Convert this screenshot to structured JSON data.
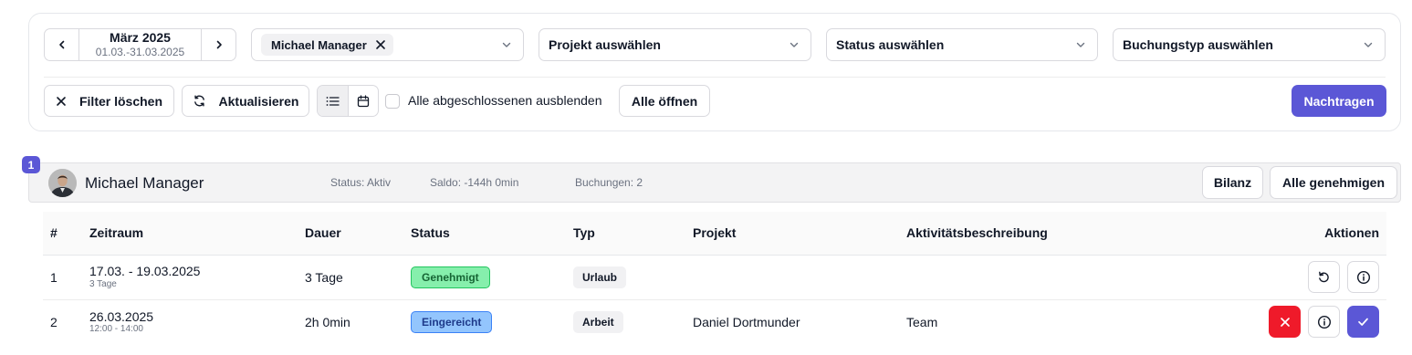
{
  "filters": {
    "month_nav": {
      "title": "März 2025",
      "range": "01.03.-31.03.2025"
    },
    "user_select": {
      "selected_chip": "Michael Manager"
    },
    "project_select": {
      "placeholder": "Projekt auswählen"
    },
    "status_select": {
      "placeholder": "Status auswählen"
    },
    "booking_type_select": {
      "placeholder": "Buchungstyp auswählen"
    },
    "clear_label": "Filter löschen",
    "refresh_label": "Aktualisieren",
    "hide_completed_label": "Alle abgeschlossenen ausblenden",
    "hide_completed_checked": false,
    "open_all_label": "Alle öffnen",
    "add_label": "Nachtragen",
    "view_mode": "list"
  },
  "group": {
    "index_badge": "1",
    "user_name": "Michael Manager",
    "status": "Status: Aktiv",
    "saldo": "Saldo: -144h 0min",
    "bookings": "Buchungen: 2",
    "balance_label": "Bilanz",
    "approve_all_label": "Alle genehmigen"
  },
  "table": {
    "headers": {
      "num": "#",
      "zeitraum": "Zeitraum",
      "dauer": "Dauer",
      "status": "Status",
      "typ": "Typ",
      "projekt": "Projekt",
      "aktivitaet": "Aktivitätsbeschreibung",
      "aktionen": "Aktionen"
    },
    "rows": [
      {
        "num": "1",
        "zeitraum": "17.03. - 19.03.2025",
        "zeitraum_sub": "3 Tage",
        "dauer": "3 Tage",
        "status": "Genehmigt",
        "typ": "Urlaub",
        "projekt": "",
        "aktivitaet": ""
      },
      {
        "num": "2",
        "zeitraum": "26.03.2025",
        "zeitraum_sub": "12:00 - 14:00",
        "dauer": "2h 0min",
        "status": "Eingereicht",
        "typ": "Arbeit",
        "projekt": "Daniel Dortmunder",
        "aktivitaet": "Team"
      }
    ]
  },
  "colors": {
    "accent": "#5b57d6",
    "danger": "#ef1a2a",
    "approved_bg": "#86efac",
    "submitted_bg": "#93c5fd"
  }
}
